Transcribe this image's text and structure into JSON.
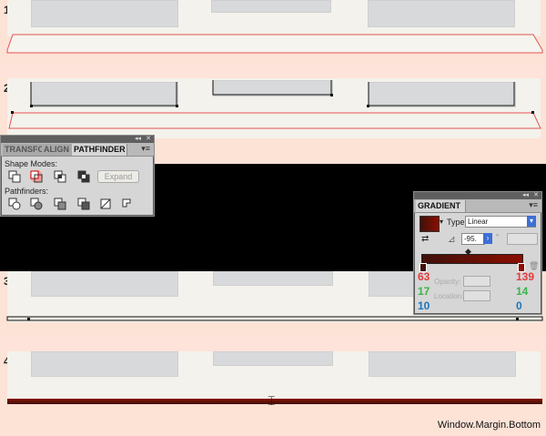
{
  "steps": {
    "one": "1.",
    "two": "2.",
    "three": "3.",
    "four": "4."
  },
  "pathfinder": {
    "tabs": [
      "TRANSFO",
      "ALIGN",
      "PATHFINDER"
    ],
    "shape_modes_label": "Shape Modes:",
    "pathfinders_label": "Pathfinders:",
    "expand_label": "Expand"
  },
  "gradient": {
    "title": "GRADIENT",
    "type_label": "Type:",
    "type_value": "Linear",
    "angle_value": "-95.",
    "opacity_label": "Opacity:",
    "location_label": "Location:",
    "left_stop": {
      "r": "63",
      "g": "17",
      "b": "10"
    },
    "right_stop": {
      "r": "139",
      "g": "14",
      "b": "0"
    }
  },
  "caption": "Window.Margin.Bottom",
  "colors": {
    "stop_left": "#3f110a",
    "stop_right": "#8b0e00",
    "red": "#e6393a",
    "green": "#39b54a",
    "blue": "#1b75bb"
  }
}
